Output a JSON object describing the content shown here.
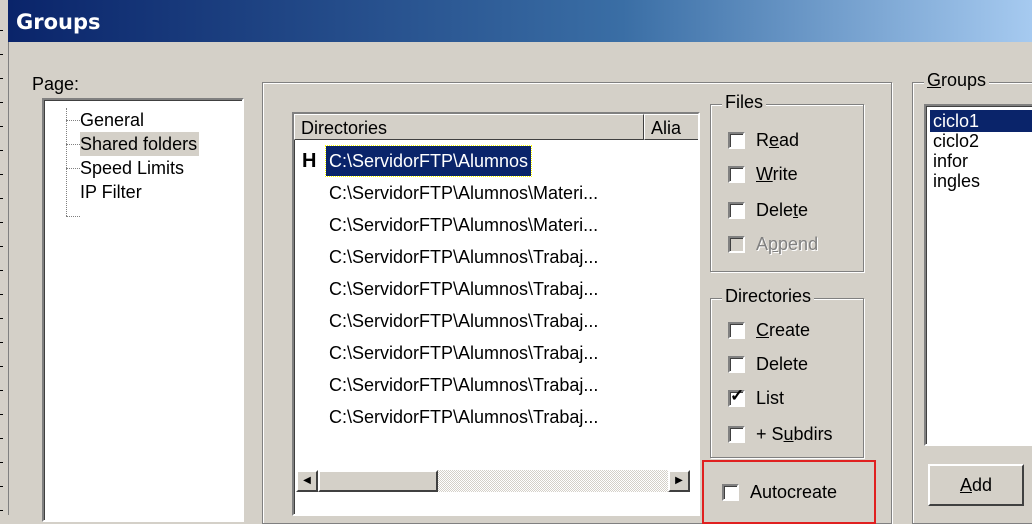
{
  "window": {
    "title": "Groups"
  },
  "page_label": "Page:",
  "tree": {
    "items": [
      {
        "label": "General",
        "selected": false
      },
      {
        "label": "Shared folders",
        "selected": true
      },
      {
        "label": "Speed Limits",
        "selected": false
      },
      {
        "label": "IP Filter",
        "selected": false
      }
    ]
  },
  "directories": {
    "columns": [
      "Directories",
      "Alia"
    ],
    "rows": [
      {
        "home": "H",
        "path": "C:\\ServidorFTP\\Alumnos",
        "selected": true
      },
      {
        "home": "",
        "path": "C:\\ServidorFTP\\Alumnos\\Materi...",
        "selected": false
      },
      {
        "home": "",
        "path": "C:\\ServidorFTP\\Alumnos\\Materi...",
        "selected": false
      },
      {
        "home": "",
        "path": "C:\\ServidorFTP\\Alumnos\\Trabaj...",
        "selected": false
      },
      {
        "home": "",
        "path": "C:\\ServidorFTP\\Alumnos\\Trabaj...",
        "selected": false
      },
      {
        "home": "",
        "path": "C:\\ServidorFTP\\Alumnos\\Trabaj...",
        "selected": false
      },
      {
        "home": "",
        "path": "C:\\ServidorFTP\\Alumnos\\Trabaj...",
        "selected": false
      },
      {
        "home": "",
        "path": "C:\\ServidorFTP\\Alumnos\\Trabaj...",
        "selected": false
      },
      {
        "home": "",
        "path": "C:\\ServidorFTP\\Alumnos\\Trabaj...",
        "selected": false
      }
    ]
  },
  "files_group": {
    "title": "Files",
    "read": {
      "pre": "R",
      "ul": "e",
      "post": "ad",
      "checked": false
    },
    "write": {
      "pre": "",
      "ul": "W",
      "post": "rite",
      "checked": false
    },
    "delete": {
      "pre": "Dele",
      "ul": "t",
      "post": "e",
      "checked": false
    },
    "append": {
      "pre": "A",
      "ul": "p",
      "post": "pend",
      "checked": false,
      "disabled": true
    }
  },
  "dirs_group": {
    "title": "Directories",
    "create": {
      "pre": "",
      "ul": "C",
      "post": "reate",
      "checked": false
    },
    "delete": {
      "label": "Delete",
      "checked": false
    },
    "list": {
      "label": "List",
      "checked": true
    },
    "subdirs": {
      "pre": "+ S",
      "ul": "u",
      "post": "bdirs",
      "checked": false
    }
  },
  "autocreate": {
    "label": "Autocreate",
    "checked": false
  },
  "groups_panel": {
    "legend_ul": "G",
    "legend_rest": "roups",
    "items": [
      {
        "label": "ciclo1",
        "selected": true
      },
      {
        "label": "ciclo2",
        "selected": false
      },
      {
        "label": "infor",
        "selected": false
      },
      {
        "label": "ingles",
        "selected": false
      }
    ],
    "add_ul": "A",
    "add_rest": "dd"
  },
  "colors": {
    "selection": "#0a246a",
    "face": "#d4d0c8",
    "highlight_box": "#e02020"
  }
}
